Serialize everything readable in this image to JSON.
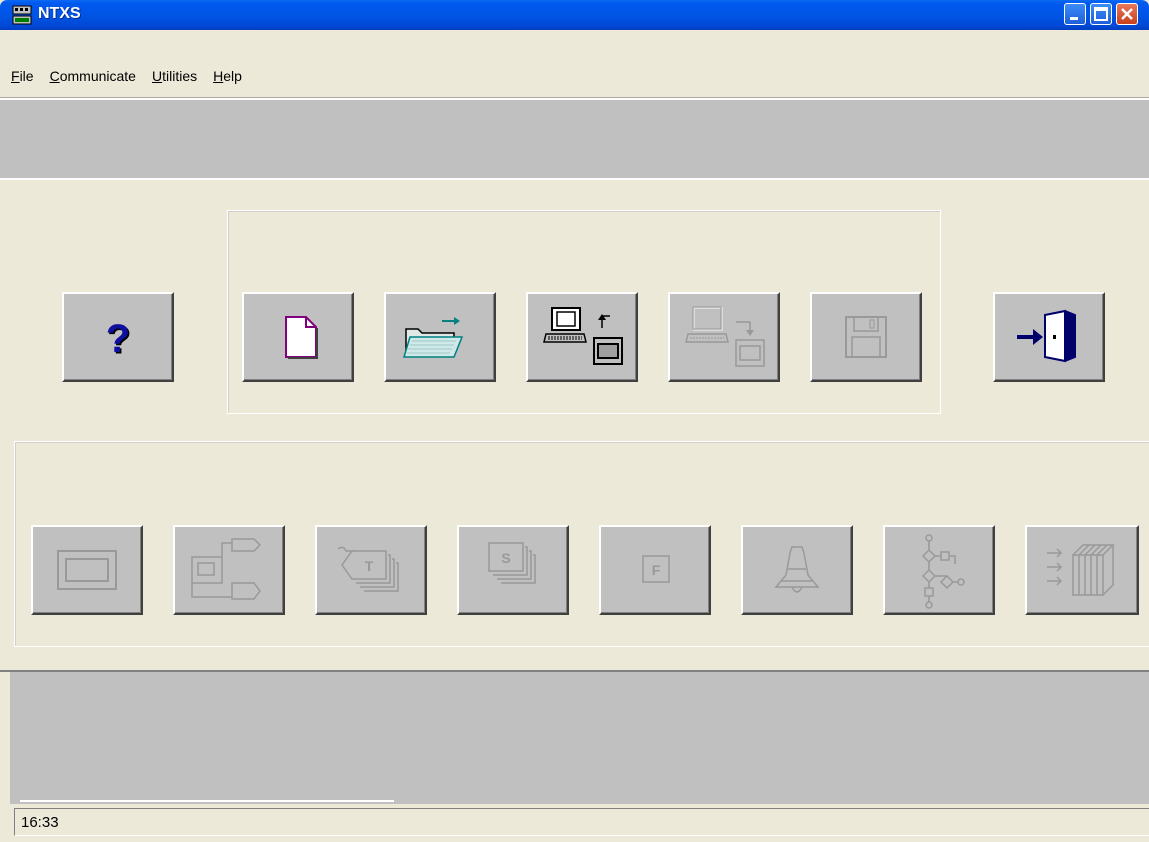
{
  "window": {
    "title": "NTXS"
  },
  "menu": [
    {
      "label_u": "F",
      "label_rest": "ile"
    },
    {
      "label_u": "C",
      "label_rest": "ommunicate"
    },
    {
      "label_u": "U",
      "label_rest": "tilities"
    },
    {
      "label_u": "H",
      "label_rest": "elp"
    }
  ],
  "toolbar_top": [
    {
      "name": "help-button",
      "icon": "question-icon",
      "enabled": true
    },
    {
      "name": "new-button",
      "icon": "new-file-icon",
      "enabled": true
    },
    {
      "name": "open-button",
      "icon": "open-folder-icon",
      "enabled": true
    },
    {
      "name": "receive-button",
      "icon": "computer-receive-icon",
      "enabled": true
    },
    {
      "name": "send-button",
      "icon": "computer-send-icon",
      "enabled": false
    },
    {
      "name": "save-button",
      "icon": "floppy-disk-icon",
      "enabled": false
    },
    {
      "name": "exit-button",
      "icon": "exit-door-icon",
      "enabled": true
    }
  ],
  "toolbar_bottom": [
    {
      "name": "screen-button",
      "icon": "screen-icon",
      "enabled": false
    },
    {
      "name": "layout-button",
      "icon": "layout-icon",
      "enabled": false
    },
    {
      "name": "tags-button",
      "icon": "tags-icon",
      "enabled": false,
      "glyph": "T"
    },
    {
      "name": "screens-button",
      "icon": "screens-icon",
      "enabled": false,
      "glyph": "S"
    },
    {
      "name": "function-button",
      "icon": "function-icon",
      "enabled": false,
      "glyph": "F"
    },
    {
      "name": "alarm-button",
      "icon": "bell-icon",
      "enabled": false
    },
    {
      "name": "network-button",
      "icon": "network-icon",
      "enabled": false
    },
    {
      "name": "archive-button",
      "icon": "archive-icon",
      "enabled": false
    }
  ],
  "status": {
    "time": "16:33"
  }
}
